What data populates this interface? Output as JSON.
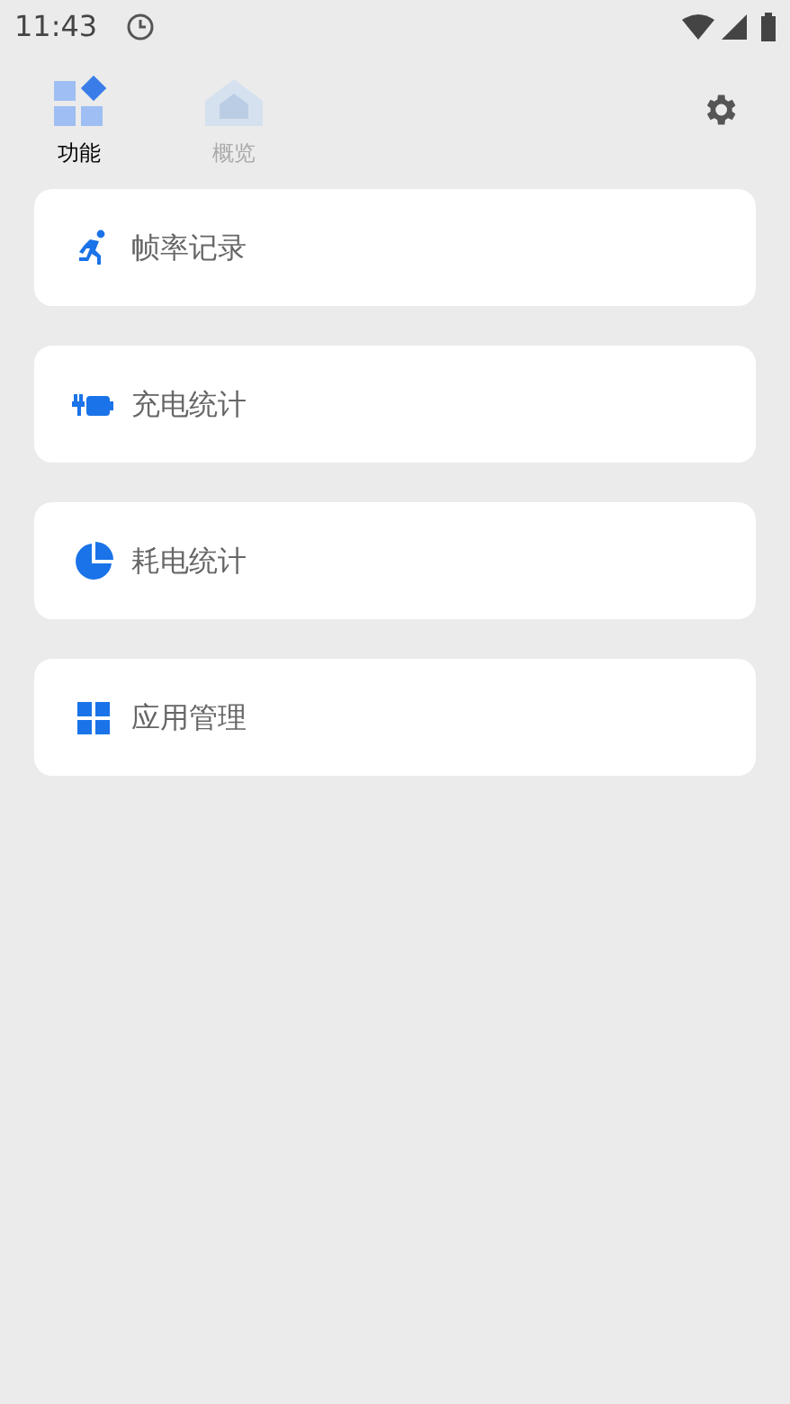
{
  "status_bar": {
    "time": "11:43"
  },
  "tabs": [
    {
      "label": "功能",
      "selected": true
    },
    {
      "label": "概览",
      "selected": false
    }
  ],
  "items": [
    {
      "kind": "run",
      "label": "帧率记录"
    },
    {
      "kind": "charge",
      "label": "充电统计"
    },
    {
      "kind": "pie",
      "label": "耗电统计"
    },
    {
      "kind": "grid",
      "label": "应用管理"
    }
  ]
}
